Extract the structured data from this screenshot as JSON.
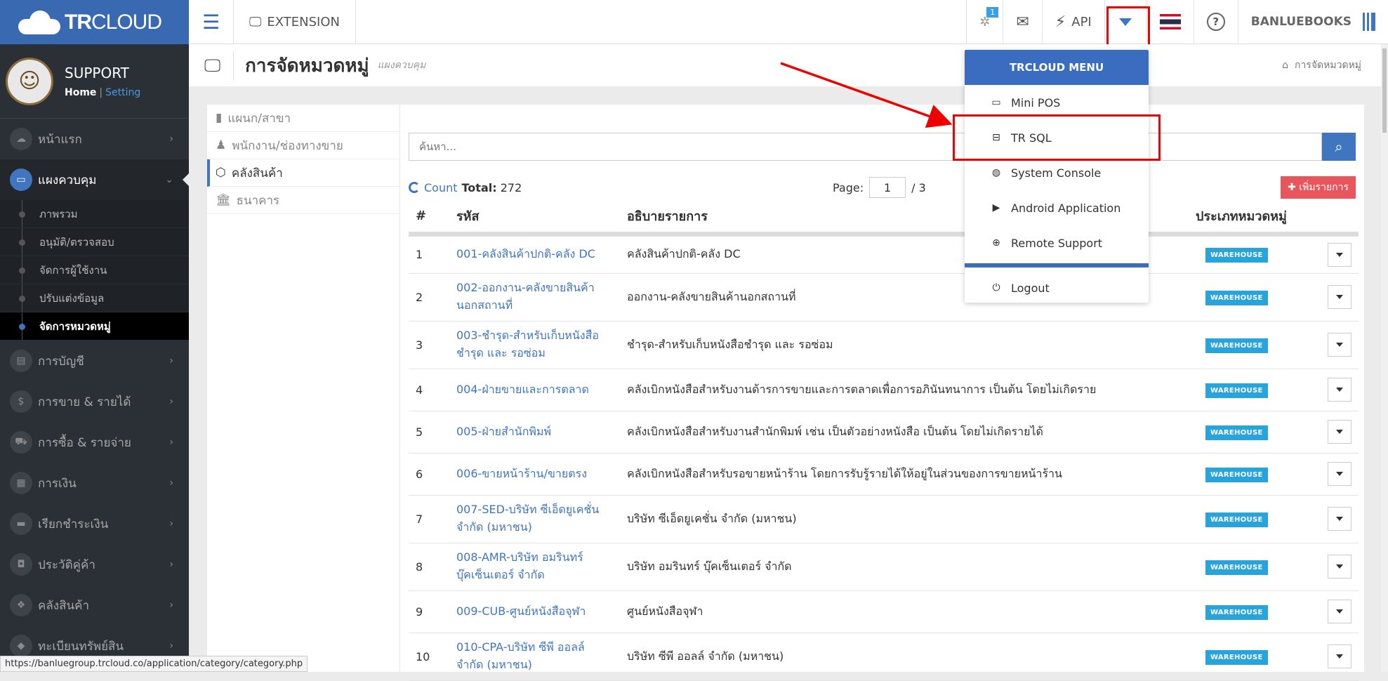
{
  "brand": {
    "name_bold": "TR",
    "name_light": "CLOUD"
  },
  "profile": {
    "name": "SUPPORT",
    "home": "Home",
    "sep": "|",
    "setting": "Setting"
  },
  "sidebar": {
    "items": [
      {
        "label": "หน้าแรก",
        "icon": "home-icon",
        "glyph": "☁"
      },
      {
        "label": "แผงควบคุม",
        "icon": "monitor-icon",
        "glyph": "▭",
        "active": true
      },
      {
        "label": "การบัญชี",
        "icon": "book-icon",
        "glyph": "▤"
      },
      {
        "label": "การขาย & รายได้",
        "icon": "dollar-icon",
        "glyph": "$"
      },
      {
        "label": "การซื้อ & รายจ่าย",
        "icon": "cart-icon",
        "glyph": "⛟"
      },
      {
        "label": "การเงิน",
        "icon": "calendar-icon",
        "glyph": "▦"
      },
      {
        "label": "เรียกชำระเงิน",
        "icon": "card-icon",
        "glyph": "▬"
      },
      {
        "label": "ประวัติคู่ค้า",
        "icon": "contact-icon",
        "glyph": "◘"
      },
      {
        "label": "คลังสินค้า",
        "icon": "cubes-icon",
        "glyph": "❖"
      },
      {
        "label": "ทะเบียนทรัพย์สิน",
        "icon": "diamond-icon",
        "glyph": "◆"
      }
    ],
    "subitems": [
      "ภาพรวม",
      "อนุมัติ/ตรวจสอบ",
      "จัดการผู้ใช้งาน",
      "ปรับแต่งข้อมูล",
      "จัดการหมวดหมู่"
    ]
  },
  "topbar": {
    "extension": "EXTENSION",
    "notif_badge": "1",
    "api": "API",
    "user": "BANLUEBOOKS"
  },
  "page": {
    "title": "การจัดหมวดหมู่",
    "subtitle": "แผงควบคุม",
    "breadcrumb": "การจัดหมวดหมู่"
  },
  "tabs": [
    {
      "label": "แผนก/สาขา",
      "icon": "building-icon",
      "glyph": "▮"
    },
    {
      "label": "พนักงาน/ช่องทางขาย",
      "icon": "user-icon",
      "glyph": "♟"
    },
    {
      "label": "คลังสินค้า",
      "icon": "cube-icon",
      "glyph": "⬡",
      "active": true
    },
    {
      "label": "ธนาคาร",
      "icon": "bank-icon",
      "glyph": "🏛"
    }
  ],
  "search": {
    "placeholder": "ค้นหา..."
  },
  "list": {
    "count_label": "Count",
    "total_label": "Total:",
    "total": "272",
    "page_label": "Page:",
    "page": "1",
    "pages": "/ 3",
    "add_label": "✚ เพิ่มรายการ"
  },
  "table": {
    "headers": [
      "#",
      "รหัส",
      "อธิบายรายการ",
      "ประเภทหมวดหมู่"
    ],
    "rows": [
      {
        "n": "1",
        "code": "001-คลังสินค้าปกติ-คลัง DC",
        "desc": "คลังสินค้าปกติ-คลัง DC",
        "type": "WAREHOUSE"
      },
      {
        "n": "2",
        "code": "002-ออกงาน-คลังขายสินค้านอกสถานที่",
        "desc": "ออกงาน-คลังขายสินค้านอกสถานที่",
        "type": "WAREHOUSE"
      },
      {
        "n": "3",
        "code": "003-ชำรุด-สำหรับเก็บหนังสือชำรุด และ รอซ่อม",
        "desc": "ชำรุด-สำหรับเก็บหนังสือชำรุด และ รอซ่อม",
        "type": "WAREHOUSE"
      },
      {
        "n": "4",
        "code": "004-ฝ่ายขายและการตลาด",
        "desc": "คลังเบิกหนังสือสำหรับงานด้ารการขายและการตลาดเพื่อการอภินันทนาการ เป็นต้น โดยไม่เกิดราย",
        "type": "WAREHOUSE"
      },
      {
        "n": "5",
        "code": "005-ฝ่ายสำนักพิมพ์",
        "desc": "คลังเบิกหนังสือสำหรับงานสำนักพิมพ์ เช่น เป็นตัวอย่างหนังสือ เป็นต้น โดยไม่เกิดรายได้",
        "type": "WAREHOUSE"
      },
      {
        "n": "6",
        "code": "006-ขายหน้าร้าน/ขายตรง",
        "desc": "คลังเบิกหนังสือสำหรับรอขายหน้าร้าน โดยการรับรู้รายได้ให้อยู่ในส่วนของการขายหน้าร้าน",
        "type": "WAREHOUSE"
      },
      {
        "n": "7",
        "code": "007-SED-บริษัท ซีเอ็ดยูเคชั่น จำกัด (มหาชน)",
        "desc": "บริษัท ซีเอ็ดยูเคชั่น จำกัด (มหาชน)",
        "type": "WAREHOUSE"
      },
      {
        "n": "8",
        "code": "008-AMR-บริษัท อมรินทร์ บุ๊คเซ็นเตอร์ จำกัด",
        "desc": "บริษัท อมรินทร์ บุ๊คเซ็นเตอร์ จำกัด",
        "type": "WAREHOUSE"
      },
      {
        "n": "9",
        "code": "009-CUB-ศูนย์หนังสือจุฬา",
        "desc": "ศูนย์หนังสือจุฬา",
        "type": "WAREHOUSE"
      },
      {
        "n": "10",
        "code": "010-CPA-บริษัท ซีพี ออลล์ จำกัด (มหาชน)",
        "desc": "บริษัท ซีพี ออลล์ จำกัด (มหาชน)",
        "type": "WAREHOUSE"
      }
    ]
  },
  "menu": {
    "title": "TRCLOUD MENU",
    "items": [
      {
        "label": "Mini POS",
        "icon": "laptop-icon",
        "glyph": "▭"
      },
      {
        "label": "TR SQL",
        "icon": "hdd-icon",
        "glyph": "⊟"
      },
      {
        "label": "System Console",
        "icon": "dashboard-icon",
        "glyph": "◍"
      },
      {
        "label": "Android Application",
        "icon": "play-icon",
        "glyph": "▶"
      },
      {
        "label": "Remote Support",
        "icon": "lifebuoy-icon",
        "glyph": "⊕"
      }
    ],
    "logout": "Logout"
  },
  "status_url": "https://banluegroup.trcloud.co/application/category/category.php",
  "colors": {
    "brand": "#3869b1",
    "accent": "#3f76bf",
    "warehouse": "#28a4dc",
    "add": "#e8555a",
    "highlight": "#e00000"
  }
}
